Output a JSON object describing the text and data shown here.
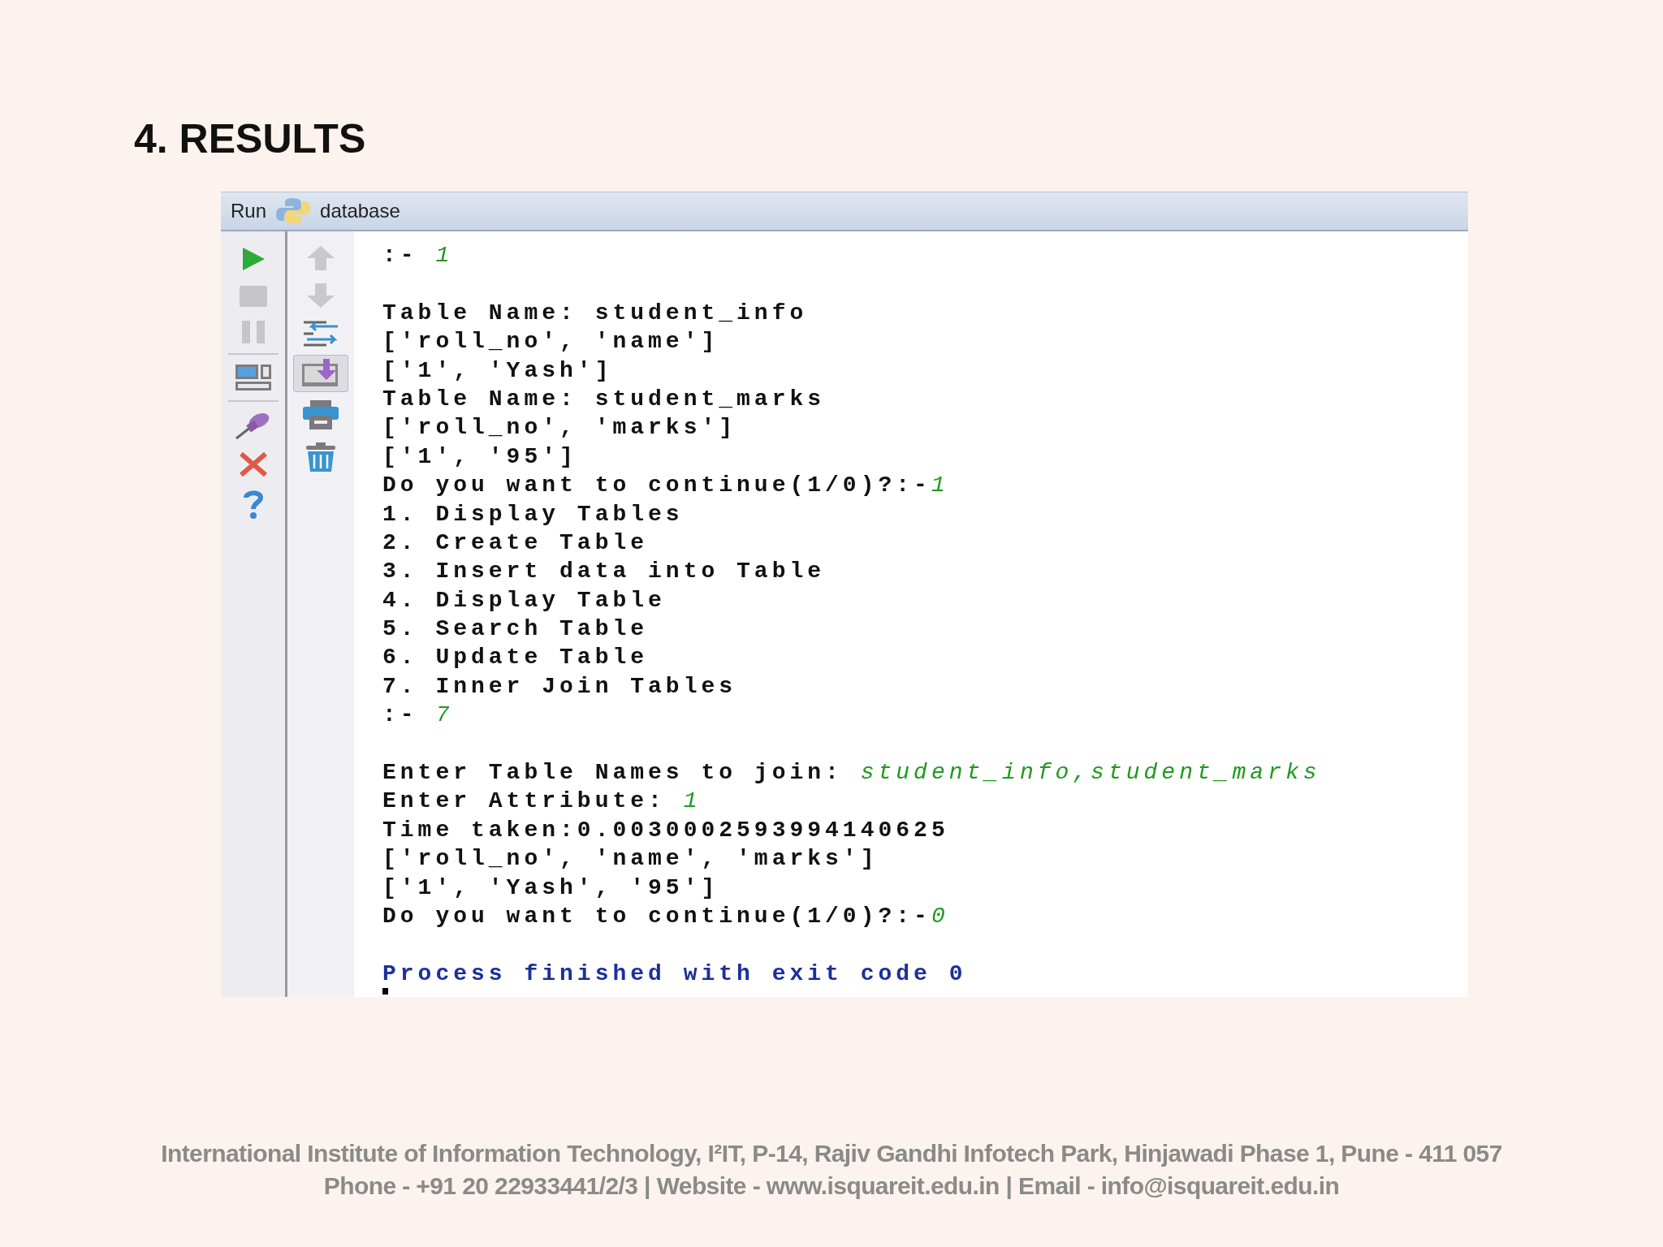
{
  "slide_title": "4. RESULTS",
  "run_panel": {
    "tab_label": "Run",
    "config_name": "database",
    "autoscroll": {
      "on": true
    },
    "console": [
      {
        "kind": "text",
        "segments": [
          {
            "kind": "output",
            "text": ":- "
          },
          {
            "kind": "input",
            "text": "1"
          }
        ]
      },
      {
        "kind": "blank"
      },
      {
        "kind": "text",
        "segments": [
          {
            "kind": "output",
            "text": "Table Name: student_info"
          }
        ]
      },
      {
        "kind": "text",
        "segments": [
          {
            "kind": "output",
            "text": "['roll_no', 'name']"
          }
        ]
      },
      {
        "kind": "text",
        "segments": [
          {
            "kind": "output",
            "text": "['1', 'Yash']"
          }
        ]
      },
      {
        "kind": "text",
        "segments": [
          {
            "kind": "output",
            "text": "Table Name: student_marks"
          }
        ]
      },
      {
        "kind": "text",
        "segments": [
          {
            "kind": "output",
            "text": "['roll_no', 'marks']"
          }
        ]
      },
      {
        "kind": "text",
        "segments": [
          {
            "kind": "output",
            "text": "['1', '95']"
          }
        ]
      },
      {
        "kind": "text",
        "segments": [
          {
            "kind": "output",
            "text": "Do you want to continue(1/0)?:-"
          },
          {
            "kind": "input",
            "text": "1"
          }
        ]
      },
      {
        "kind": "text",
        "segments": [
          {
            "kind": "output",
            "text": "1. Display Tables"
          }
        ]
      },
      {
        "kind": "text",
        "segments": [
          {
            "kind": "output",
            "text": "2. Create Table"
          }
        ]
      },
      {
        "kind": "text",
        "segments": [
          {
            "kind": "output",
            "text": "3. Insert data into Table"
          }
        ]
      },
      {
        "kind": "text",
        "segments": [
          {
            "kind": "output",
            "text": "4. Display Table"
          }
        ]
      },
      {
        "kind": "text",
        "segments": [
          {
            "kind": "output",
            "text": "5. Search Table"
          }
        ]
      },
      {
        "kind": "text",
        "segments": [
          {
            "kind": "output",
            "text": "6. Update Table"
          }
        ]
      },
      {
        "kind": "text",
        "segments": [
          {
            "kind": "output",
            "text": "7. Inner Join Tables"
          }
        ]
      },
      {
        "kind": "text",
        "segments": [
          {
            "kind": "output",
            "text": ":- "
          },
          {
            "kind": "input",
            "text": "7"
          }
        ]
      },
      {
        "kind": "blank"
      },
      {
        "kind": "text",
        "segments": [
          {
            "kind": "output",
            "text": "Enter Table Names to join: "
          },
          {
            "kind": "input",
            "text": "student_info,student_marks"
          }
        ]
      },
      {
        "kind": "text",
        "segments": [
          {
            "kind": "output",
            "text": "Enter Attribute: "
          },
          {
            "kind": "input",
            "text": "1"
          }
        ]
      },
      {
        "kind": "text",
        "segments": [
          {
            "kind": "output",
            "text": "Time taken:0.0030002593994140625"
          }
        ]
      },
      {
        "kind": "text",
        "segments": [
          {
            "kind": "output",
            "text": "['roll_no', 'name', 'marks']"
          }
        ]
      },
      {
        "kind": "text",
        "segments": [
          {
            "kind": "output",
            "text": "['1', 'Yash', '95']"
          }
        ]
      },
      {
        "kind": "text",
        "segments": [
          {
            "kind": "output",
            "text": "Do you want to continue(1/0)?:-"
          },
          {
            "kind": "input",
            "text": "0"
          }
        ]
      },
      {
        "kind": "blank"
      },
      {
        "kind": "text",
        "segments": [
          {
            "kind": "system",
            "text": "Process finished with exit code 0"
          }
        ]
      }
    ]
  },
  "footer": [
    "International Institute of Information Technology, I²IT, P-14, Rajiv Gandhi Infotech Park, Hinjawadi Phase 1, Pune - 411 057",
    "Phone - +91 20 22933441/2/3 | Website - www.isquareit.edu.in | Email - info@isquareit.edu.in"
  ]
}
